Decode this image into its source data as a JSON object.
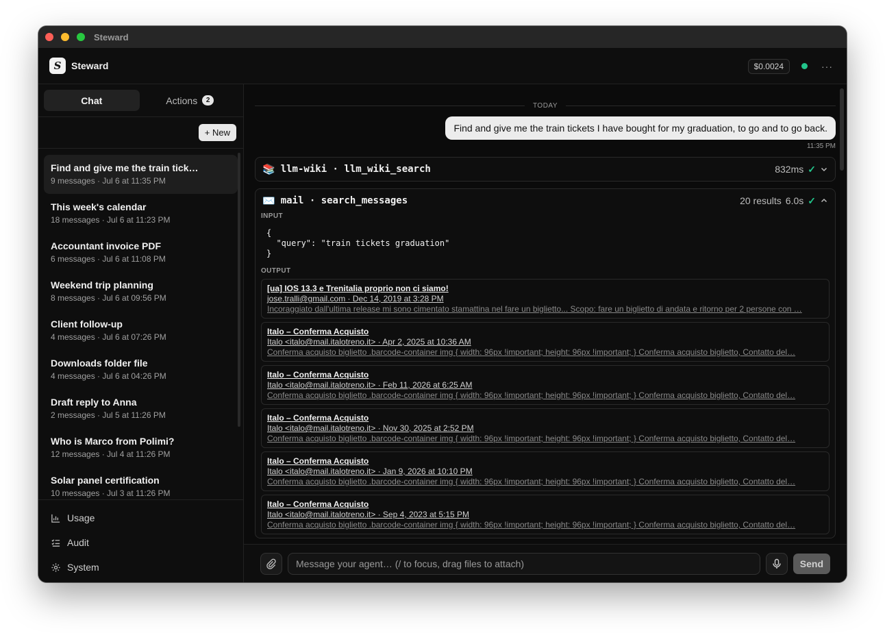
{
  "window": {
    "title": "Steward"
  },
  "app": {
    "name": "Steward",
    "cost": "$0.0024",
    "status_color": "#22c58b"
  },
  "sidebar": {
    "tabs": [
      {
        "label": "Chat"
      },
      {
        "label": "Actions",
        "badge": "2"
      }
    ],
    "new_label": "+ New",
    "conversations": [
      {
        "title": "Find and give me the train tick…",
        "meta": "9 messages · Jul 6 at 11:35 PM"
      },
      {
        "title": "This week's calendar",
        "meta": "18 messages · Jul 6 at 11:23 PM"
      },
      {
        "title": "Accountant invoice PDF",
        "meta": "6 messages · Jul 6 at 11:08 PM"
      },
      {
        "title": "Weekend trip planning",
        "meta": "8 messages · Jul 6 at 09:56 PM"
      },
      {
        "title": "Client follow-up",
        "meta": "4 messages · Jul 6 at 07:26 PM"
      },
      {
        "title": "Downloads folder file",
        "meta": "4 messages · Jul 6 at 04:26 PM"
      },
      {
        "title": "Draft reply to Anna",
        "meta": "2 messages · Jul 5 at 11:26 PM"
      },
      {
        "title": "Who is Marco from Polimi?",
        "meta": "12 messages · Jul 4 at 11:26 PM"
      },
      {
        "title": "Solar panel certification",
        "meta": "10 messages · Jul 3 at 11:26 PM"
      }
    ],
    "footer": [
      {
        "label": "Usage"
      },
      {
        "label": "Audit"
      },
      {
        "label": "System"
      }
    ]
  },
  "chat": {
    "day": "TODAY",
    "user_message": "Find and give me the train tickets I have bought for my graduation, to go and to go back.",
    "user_time": "11:35 PM",
    "tool1": {
      "icon": "📚",
      "name": "llm-wiki · llm_wiki_search",
      "duration": "832ms"
    },
    "tool2": {
      "icon": "✉️",
      "name": "mail · search_messages",
      "results": "20 results",
      "duration": "6.0s",
      "input_label": "INPUT",
      "input_code": "{\n  \"query\": \"train tickets graduation\"\n}",
      "output_label": "OUTPUT",
      "items": [
        {
          "title": "[ua] IOS 13.3 e Trenitalia proprio non ci siamo!",
          "meta": "jose.tralli@gmail.com · Dec 14, 2019 at 3:28 PM",
          "snippet": "Incoraggiato dall'ultima release mi sono cimentato stamattina nel fare un biglietto... Scopo: fare un biglietto di andata e ritorno per 2 persone con …"
        },
        {
          "title": "Italo – Conferma Acquisto",
          "meta": "Italo <italo@mail.italotreno.it> · Apr 2, 2025 at 10:36 AM",
          "snippet": "Conferma acquisto biglietto .barcode-container img { width: 96px !important; height: 96px !important; } Conferma acquisto biglietto, Contatto del…"
        },
        {
          "title": "Italo – Conferma Acquisto",
          "meta": "Italo <italo@mail.italotreno.it> · Feb 11, 2026 at 6:25 AM",
          "snippet": "Conferma acquisto biglietto .barcode-container img { width: 96px !important; height: 96px !important; } Conferma acquisto biglietto, Contatto del…"
        },
        {
          "title": "Italo – Conferma Acquisto",
          "meta": "Italo <italo@mail.italotreno.it> · Nov 30, 2025 at 2:52 PM",
          "snippet": "Conferma acquisto biglietto .barcode-container img { width: 96px !important; height: 96px !important; } Conferma acquisto biglietto, Contatto del…"
        },
        {
          "title": "Italo – Conferma Acquisto",
          "meta": "Italo <italo@mail.italotreno.it> · Jan 9, 2026 at 10:10 PM",
          "snippet": "Conferma acquisto biglietto .barcode-container img { width: 96px !important; height: 96px !important; } Conferma acquisto biglietto, Contatto del…"
        },
        {
          "title": "Italo – Conferma Acquisto",
          "meta": "Italo <italo@mail.italotreno.it> · Sep 4, 2023 at 5:15 PM",
          "snippet": "Conferma acquisto biglietto .barcode-container img { width: 96px !important; height: 96px !important; } Conferma acquisto biglietto, Contatto del…"
        }
      ]
    }
  },
  "composer": {
    "placeholder": "Message your agent…  (/ to focus, drag files to attach)",
    "send_label": "Send"
  }
}
